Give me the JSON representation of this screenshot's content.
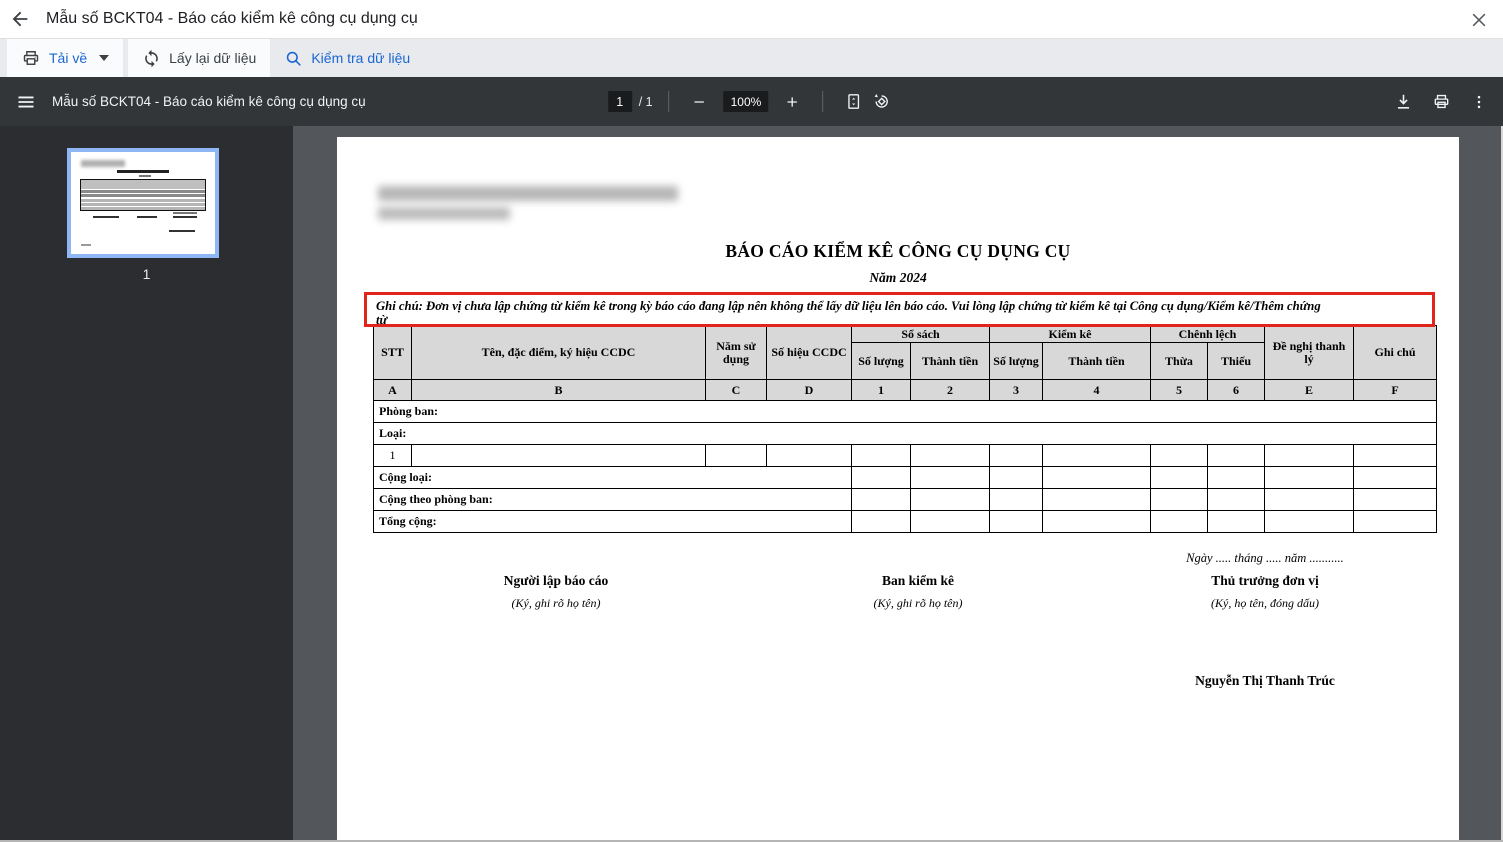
{
  "app_header": {
    "title": "Mẫu số BCKT04 - Báo cáo kiểm kê công cụ dụng cụ"
  },
  "action_toolbar": {
    "download_label": "Tải về",
    "reload_label": "Lấy lại dữ liệu",
    "check_label": "Kiểm tra dữ liệu"
  },
  "pdf_toolbar": {
    "title": "Mẫu số BCKT04 - Báo cáo kiểm kê công cụ dụng cụ",
    "page_current": "1",
    "page_total": "/ 1",
    "zoom_value": "100%"
  },
  "sidebar": {
    "thumbnail_page_number": "1"
  },
  "document": {
    "title": "BÁO CÁO KIỂM KÊ CÔNG CỤ DỤNG CỤ",
    "subtitle": "Năm 2024",
    "note_line1": "Ghi chú: Đơn vị chưa lập chứng từ kiểm kê trong kỳ báo cáo đang lập nên không thể lấy dữ liệu lên báo cáo. Vui lòng lập chứng từ kiểm kê tại Công cụ dụng/Kiểm kê/Thêm chứng",
    "note_line2": "từ",
    "table": {
      "col_stt": "STT",
      "col_name": "Tên, đặc điểm, ký hiệu CCDC",
      "col_year": "Năm sử dụng",
      "col_code": "Số hiệu CCDC",
      "grp_book": "Sổ sách",
      "grp_inventory": "Kiểm kê",
      "grp_diff": "Chênh lệch",
      "col_qty": "Số lượng",
      "col_amount": "Thành tiền",
      "col_surplus": "Thừa",
      "col_shortage": "Thiếu",
      "col_disposal": "Đề nghị thanh lý",
      "col_note": "Ghi chú",
      "letters": [
        "A",
        "B",
        "C",
        "D",
        "1",
        "2",
        "3",
        "4",
        "5",
        "6",
        "E",
        "F"
      ],
      "row_department": "Phòng ban:",
      "row_type": "Loại:",
      "row_index": "1",
      "row_sum_type": "Cộng loại:",
      "row_sum_department": "Cộng theo phòng ban:",
      "row_total": "Tổng cộng:"
    },
    "date_line": "Ngày ..... tháng ..... năm ...........",
    "signatures": [
      {
        "title": "Người lập báo cáo",
        "sub": "(Ký, ghi rõ họ tên)"
      },
      {
        "title": "Ban kiểm kê",
        "sub": "(Ký, ghi rõ họ tên)"
      },
      {
        "title": "Thủ trưởng đơn vị",
        "sub": "(Ký, họ tên, đóng dấu)"
      }
    ],
    "signer_name": "Nguyễn Thị Thanh Trúc"
  }
}
